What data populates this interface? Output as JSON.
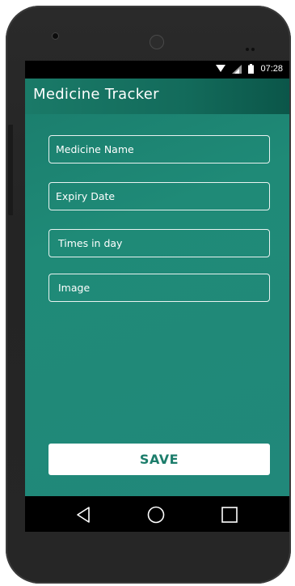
{
  "status_bar": {
    "time": "07:28",
    "icons": [
      "wifi-icon",
      "signal-icon",
      "battery-icon"
    ]
  },
  "app_bar": {
    "title": "Medicine Tracker"
  },
  "form": {
    "fields": [
      {
        "placeholder": "Medicine Name"
      },
      {
        "placeholder": "Expiry Date"
      },
      {
        "placeholder": "Times in day"
      },
      {
        "placeholder": "Image"
      }
    ],
    "save_label": "SAVE"
  },
  "nav_bar": {
    "items": [
      "back-icon",
      "home-icon",
      "recents-icon"
    ]
  },
  "colors": {
    "primary": "#1f8a77",
    "primary_dark": "#0b5649",
    "button_text": "#1c7d6b"
  }
}
